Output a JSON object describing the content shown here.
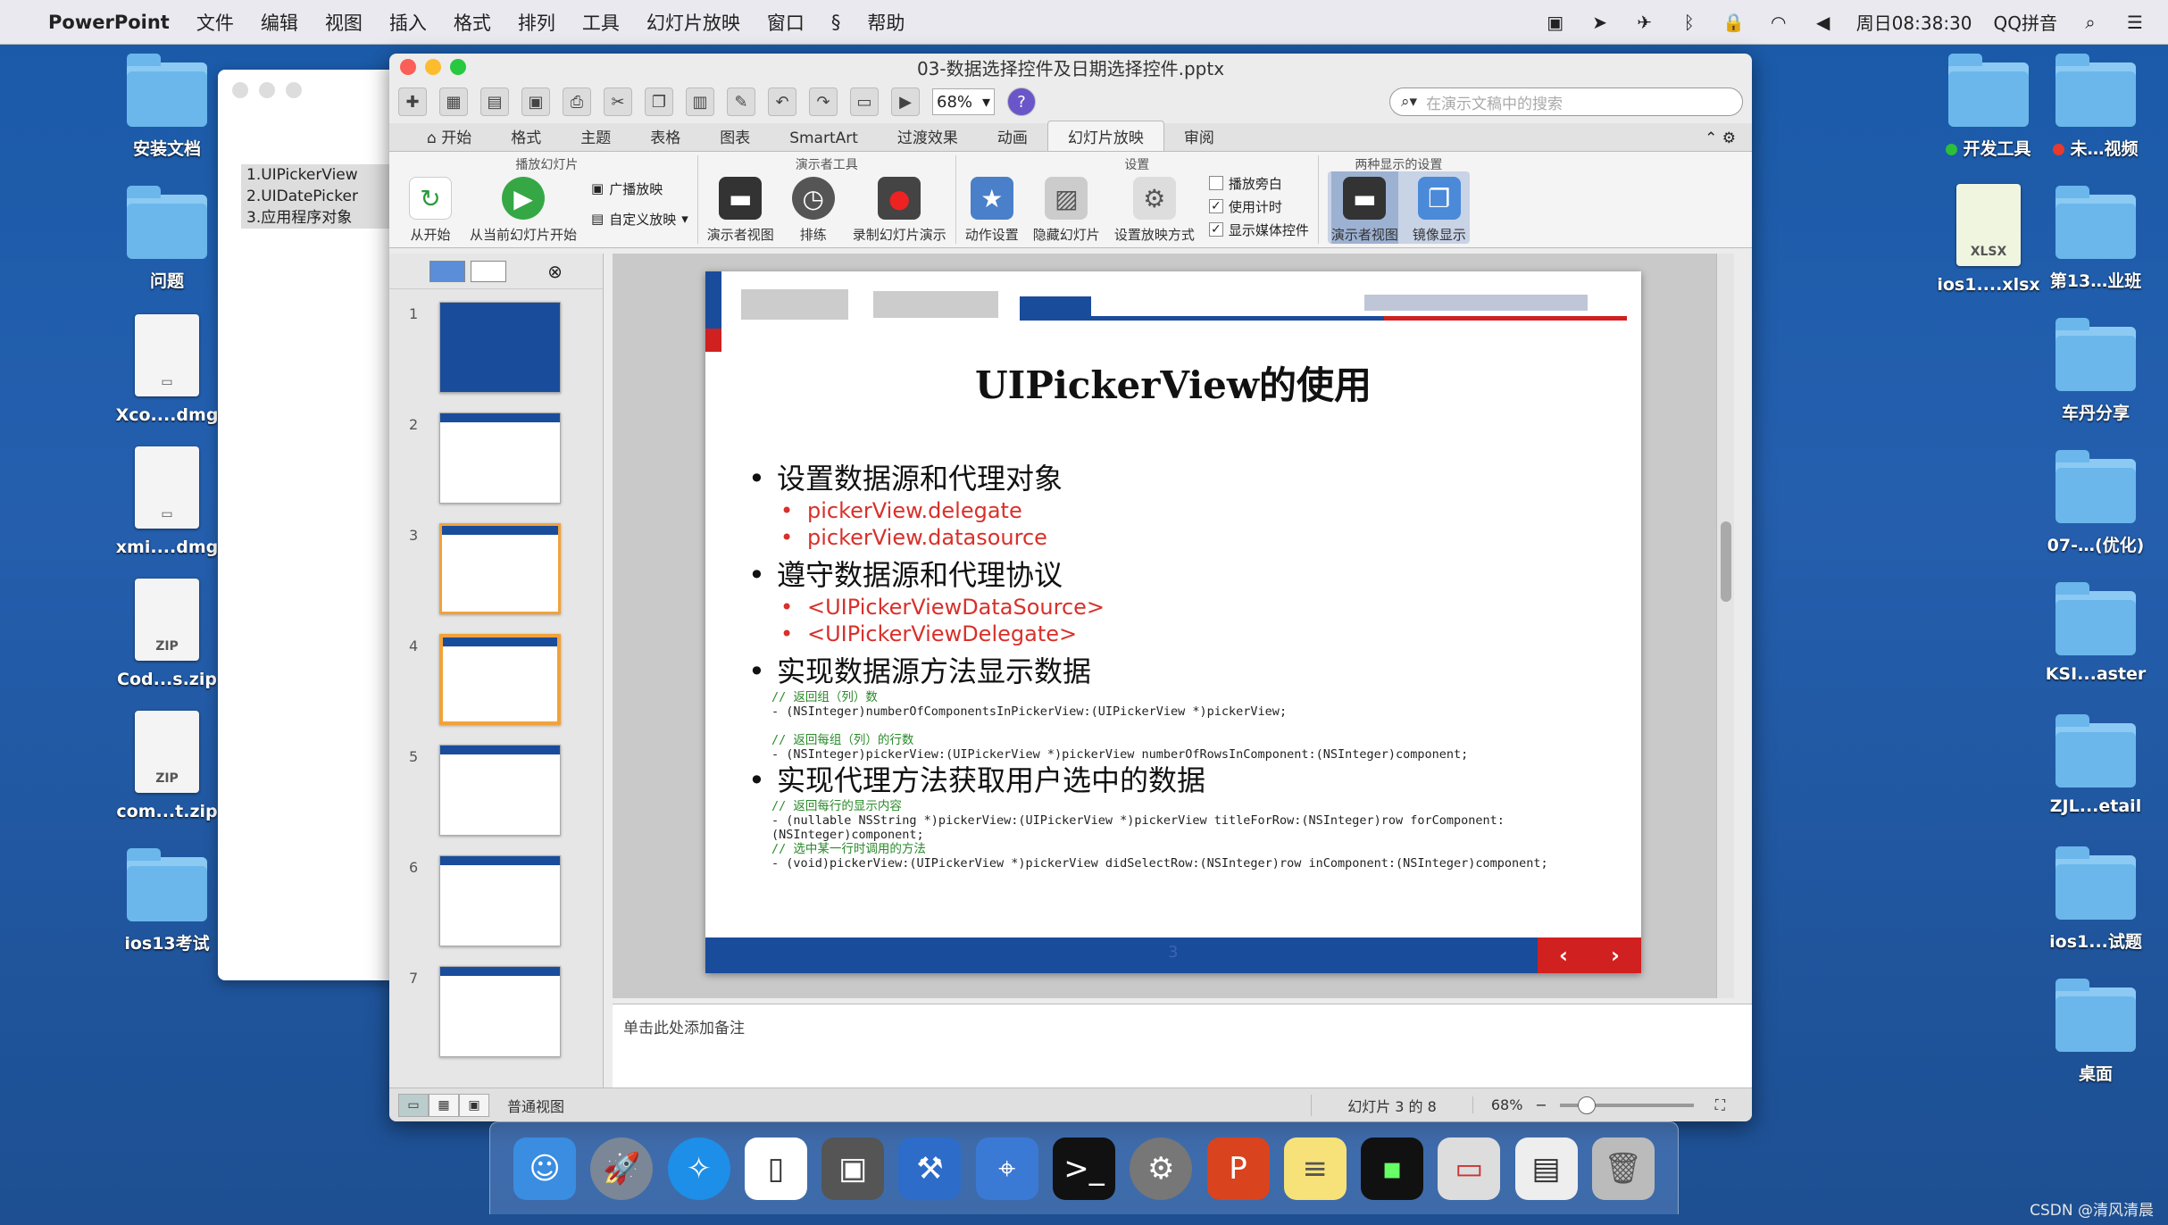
{
  "menubar": {
    "app": "PowerPoint",
    "items": [
      "文件",
      "编辑",
      "视图",
      "插入",
      "格式",
      "排列",
      "工具",
      "幻灯片放映",
      "窗口",
      "帮助"
    ],
    "clock": "周日08:38:30",
    "ime": "QQ拼音"
  },
  "desktop_left": [
    "安装文档",
    "问题",
    "Xco....dmg",
    "xmi....dmg",
    "Cod...s.zip",
    "com...t.zip",
    "ios13考试"
  ],
  "desktop_right": [
    {
      "label": "开发工具",
      "dot": "#2dbe3c"
    },
    {
      "label": "未…视频",
      "dot": "#e83a2f"
    },
    {
      "label": "ios1....xlsx",
      "badge": "XLSX"
    },
    {
      "label": "第13…业班"
    },
    {
      "label": "车丹分享"
    },
    {
      "label": "07-…(优化)"
    },
    {
      "label": "KSI...aster"
    },
    {
      "label": "ZJL...etail"
    },
    {
      "label": "ios1...试题"
    },
    {
      "label": "桌面"
    }
  ],
  "zip_badge": "ZIP",
  "outline": [
    "1.UIPickerView",
    "2.UIDatePicker",
    "3.应用程序对象"
  ],
  "window": {
    "title": "03-数据选择控件及日期选择控件.pptx",
    "zoom": "68%",
    "search_placeholder": "在演示文稿中的搜索",
    "tabs": [
      "开始",
      "格式",
      "主题",
      "表格",
      "图表",
      "SmartArt",
      "过渡效果",
      "动画",
      "幻灯片放映",
      "审阅"
    ],
    "active_tab": "幻灯片放映"
  },
  "ribbon": {
    "groups": [
      {
        "title": "播放幻灯片",
        "buttons": [
          "从开始",
          "从当前幻灯片开始"
        ],
        "small": [
          "广播放映",
          "自定义放映"
        ]
      },
      {
        "title": "演示者工具",
        "buttons": [
          "演示者视图",
          "排练",
          "录制幻灯片演示"
        ]
      },
      {
        "title": "设置",
        "buttons": [
          "动作设置",
          "隐藏幻灯片",
          "设置放映方式"
        ],
        "checks": [
          "播放旁白",
          "使用计时",
          "显示媒体控件"
        ],
        "checked": [
          false,
          true,
          true
        ]
      },
      {
        "title": "两种显示的设置",
        "buttons": [
          "演示者视图",
          "镜像显示"
        ]
      }
    ]
  },
  "slide": {
    "title": "UIPickerView的使用",
    "page": "3",
    "bullets": [
      {
        "text": "设置数据源和代理对象",
        "subs": [
          "pickerView.delegate",
          "pickerView.datasource"
        ]
      },
      {
        "text": "遵守数据源和代理协议",
        "subs": [
          "<UIPickerViewDataSource>",
          "<UIPickerViewDelegate>"
        ]
      },
      {
        "text": "实现数据源方法显示数据",
        "code": [
          {
            "c": "// 返回组（列）数"
          },
          {
            "t": "- (NSInteger)numberOfComponentsInPickerView:(UIPickerView *)pickerView;"
          },
          {
            "c": "// 返回每组（列）的行数"
          },
          {
            "t": "- (NSInteger)pickerView:(UIPickerView *)pickerView numberOfRowsInComponent:(NSInteger)component;"
          }
        ]
      },
      {
        "text": "实现代理方法获取用户选中的数据",
        "code": [
          {
            "c": "// 返回每行的显示内容"
          },
          {
            "t": "- (nullable NSString *)pickerView:(UIPickerView *)pickerView titleForRow:(NSInteger)row forComponent:"
          },
          {
            "t": "(NSInteger)component;"
          },
          {
            "c": "// 选中某一行时调用的方法"
          },
          {
            "t": "- (void)pickerView:(UIPickerView *)pickerView didSelectRow:(NSInteger)row inComponent:(NSInteger)component;"
          }
        ]
      }
    ]
  },
  "thumbnail_numbers": [
    "1",
    "2",
    "3",
    "4",
    "5",
    "6",
    "7"
  ],
  "notes_placeholder": "单击此处添加备注",
  "status": {
    "view": "普通视图",
    "slide_counter": "幻灯片 3 的 8",
    "zoom": "68%"
  },
  "credit": "CSDN @清风清晨",
  "colors": {
    "accent": "#1a4c9c",
    "red": "#d02020",
    "desktop": "#245fae"
  }
}
